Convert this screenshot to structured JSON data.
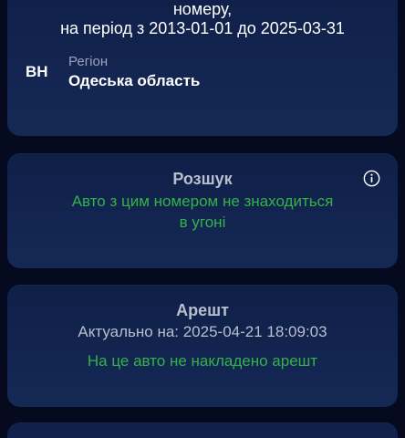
{
  "period": {
    "line1": "номеру,",
    "line2": "на період з 2013-01-01 до 2025-03-31"
  },
  "region": {
    "code": "ВН",
    "label": "Регіон",
    "value": "Одеська область"
  },
  "search": {
    "title": "Розшук",
    "status_line1": "Авто з цим номером не знаходиться",
    "status_line2": "в угоні",
    "info_icon": "info-circle-icon"
  },
  "arrest": {
    "title": "Арешт",
    "actual": "Актуально на: 2025-04-21 18:09:03",
    "status": "На це авто не накладено арешт"
  },
  "colors": {
    "background": "#050a1e",
    "card": "#12254f",
    "success": "#33b24a",
    "muted": "#b8bfcf"
  }
}
